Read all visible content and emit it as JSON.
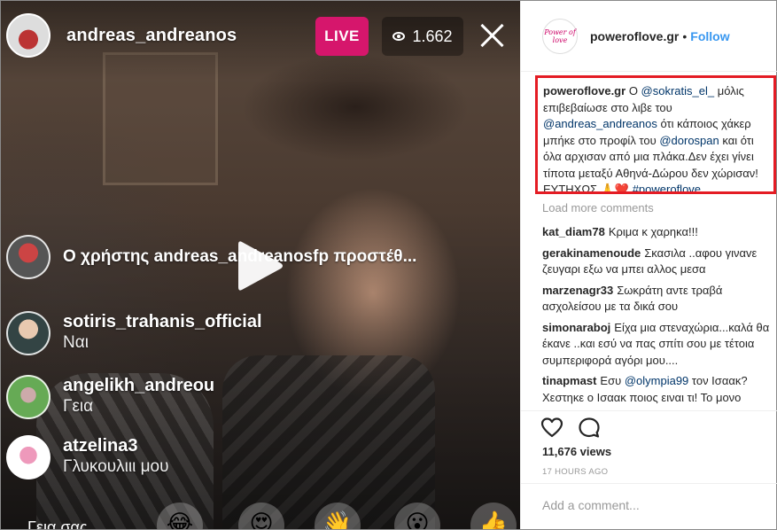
{
  "live": {
    "host_name": "andreas_andreanos",
    "live_label": "LIVE",
    "viewer_count": "1.662",
    "system_message": "Ο χρήστης andreas_andreanosfp προστέθ...",
    "chat": [
      {
        "user": "sotiris_trahanis_official",
        "message": "Ναι"
      },
      {
        "user": "angelikh_andreou",
        "message": "Γεια"
      },
      {
        "user": "atzelina3",
        "message": "Γλυκουλιιι μου"
      }
    ],
    "bottom_message": "Γεια σας",
    "reactions": [
      "😂",
      "😍",
      "👋",
      "😮",
      "👍",
      "🎉"
    ]
  },
  "post": {
    "account": "poweroflove.gr",
    "follow_label": "Follow",
    "avatar_text": "Power of love",
    "caption": {
      "author": "poweroflove.gr",
      "parts": [
        {
          "t": "Ο "
        },
        {
          "t": "@sokratis_el_",
          "mention": true
        },
        {
          "t": " μόλις επιβεβαίωσε στο λιβε του "
        },
        {
          "t": "@andreas_andreanos",
          "mention": true
        },
        {
          "t": " ότι κάποιος χάκερ μπήκε στο προφίλ του "
        },
        {
          "t": "@dorospan",
          "mention": true
        },
        {
          "t": " και ότι όλα αρχισαν από μια πλάκα.Δεν έχει γίνει τίποτα μεταξύ Αθηνά-Δώρου δεν χώρισαν!ΕΥΤΗΧΩΣ 🙏❤️ "
        },
        {
          "t": "#poweroflove",
          "mention": true
        }
      ]
    },
    "load_more_label": "Load more comments",
    "comments": [
      {
        "user": "kat_diam78",
        "text": "Κριμα κ χαρηκα!!!"
      },
      {
        "user": "gerakinamenoude",
        "text": "Σκασιλα ..αφου γιναvε ζευγαρι εξω να μπει αλλος μεσα"
      },
      {
        "user": "marzenagr33",
        "text": "Σωκράτη αντε τραβά ασχολείσου με τα δικά σου"
      },
      {
        "user": "simonaraboj",
        "text": "Είχα μια στεναχώρια...καλά θα έκανε ..και εσύ να πας σπίτι σου με τέτοια συμπεριφορά αγόρι μου...."
      },
      {
        "user": "tinapmast",
        "text_parts": [
          {
            "t": "Εσυ "
          },
          {
            "t": "@olympia99",
            "mention": true
          },
          {
            "t": " τον Ισαακ? Χεστηκε ο Ισαακ ποιος ειναι τι! Το μονο"
          }
        ]
      }
    ],
    "views": "11,676 views",
    "timestamp": "17 HOURS AGO",
    "add_comment_placeholder": "Add a comment..."
  }
}
